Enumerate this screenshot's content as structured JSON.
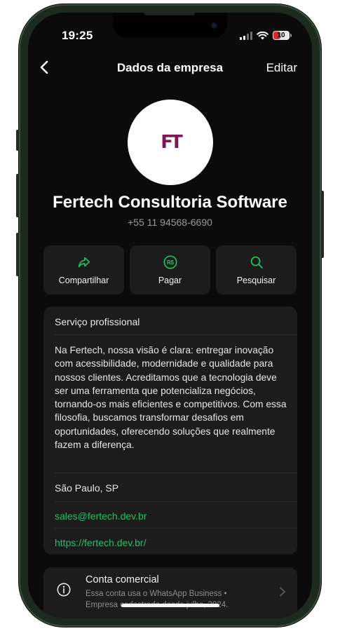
{
  "status_bar": {
    "time": "19:25",
    "battery": "10"
  },
  "nav": {
    "title": "Dados da empresa",
    "edit_label": "Editar"
  },
  "profile": {
    "logo_text": "FT",
    "name": "Fertech Consultoria Software",
    "phone": "+55 11 94568-6690"
  },
  "actions": [
    {
      "label": "Compartilhar",
      "icon": "share-icon"
    },
    {
      "label": "Pagar",
      "icon": "pay-icon"
    },
    {
      "label": "Pesquisar",
      "icon": "search-icon"
    }
  ],
  "business": {
    "category": "Serviço profissional",
    "description": "Na Fertech, nossa visão é clara: entregar inovação com acessibilidade, modernidade e qualidade para nossos clientes. Acreditamos que a tecnologia deve ser uma ferramenta que potencializa negócios, tornando-os mais eficientes e competitivos. Com essa filosofia, buscamos transformar desafios em oportunidades, oferecendo soluções que realmente fazem a diferença.",
    "location": "São Paulo, SP",
    "email": "sales@fertech.dev.br",
    "website": "https://fertech.dev.br/"
  },
  "account": {
    "title": "Conta comercial",
    "subtitle": "Essa conta usa o WhatsApp Business • Empresa cadastrada desde julho, 2024."
  },
  "colors": {
    "accent": "#21c063",
    "background": "#0b0b0b",
    "card": "#1c1c1c",
    "logo": "#7a1a55"
  }
}
